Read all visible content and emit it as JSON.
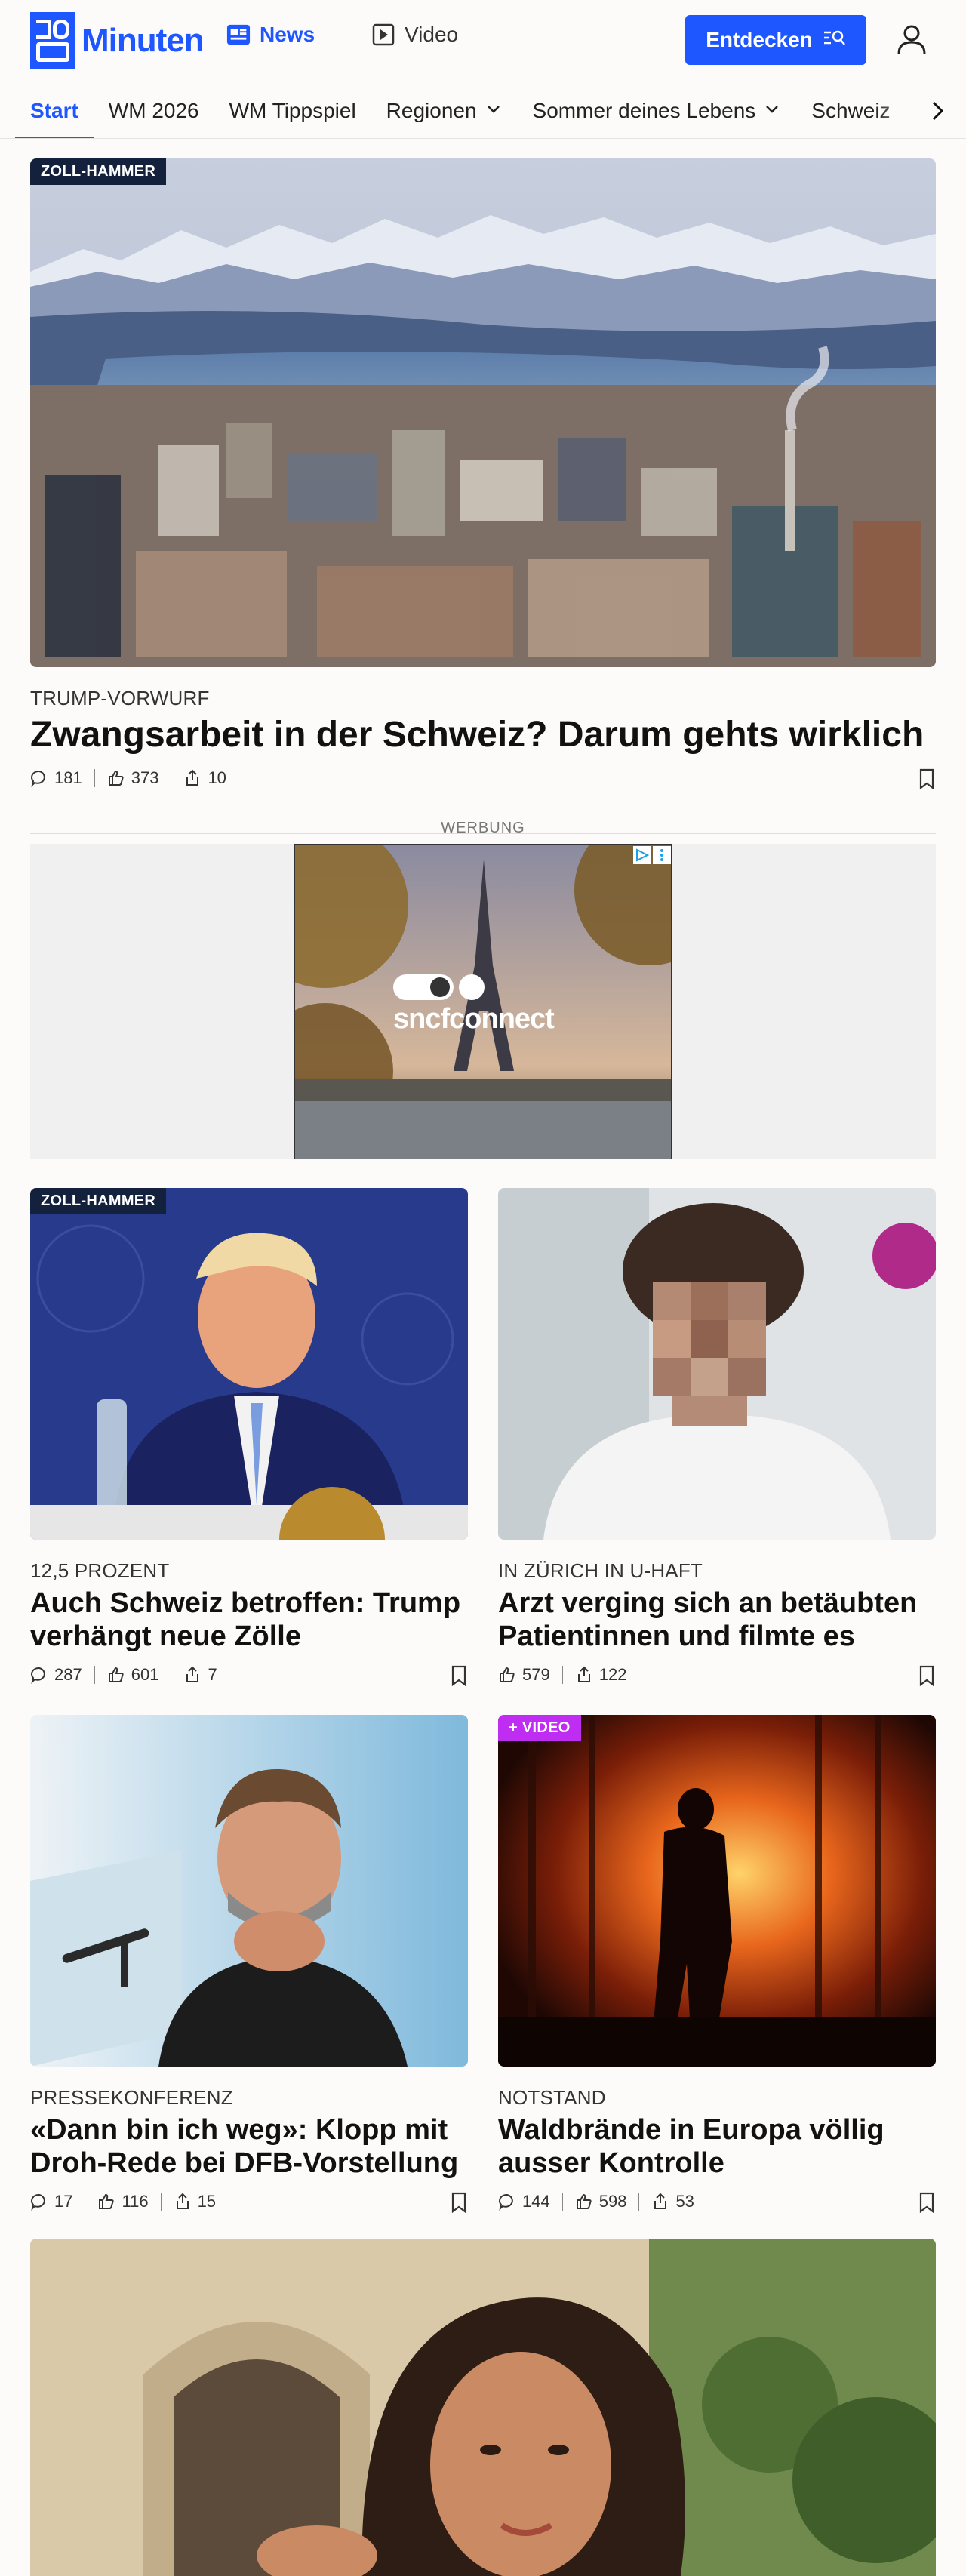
{
  "header": {
    "logo_text": "Minuten",
    "nav_news": "News",
    "nav_video": "Video",
    "discover_button": "Entdecken"
  },
  "subnav": {
    "items": [
      "Start",
      "WM 2026",
      "WM Tippspiel",
      "Regionen",
      "Sommer deines Lebens",
      "Schweiz"
    ]
  },
  "articles": [
    {
      "badge": "ZOLL-HAMMER",
      "kicker": "TRUMP-VORWURF",
      "title": "Zwangsarbeit in der Schweiz? Darum gehts wirklich",
      "comments": "181",
      "likes": "373",
      "shares": "10"
    },
    {
      "badge": "ZOLL-HAMMER",
      "kicker": "12,5 PROZENT",
      "title": "Auch Schweiz betroffen: Trump verhängt neue Zölle",
      "comments": "287",
      "likes": "601",
      "shares": "7"
    },
    {
      "kicker": "IN ZÜRICH IN U-HAFT",
      "title": "Arzt verging sich an betäubten Patientinnen und filmte es",
      "likes": "579",
      "shares": "122"
    },
    {
      "kicker": "PRESSEKONFERENZ",
      "title": "«Dann bin ich weg»: Klopp mit Droh-Rede bei DFB-Vorstellung",
      "comments": "17",
      "likes": "116",
      "shares": "15"
    },
    {
      "badge": "+ VIDEO",
      "kicker": "NOTSTAND",
      "title": "Waldbrände in Europa völlig ausser Kontrolle",
      "comments": "144",
      "likes": "598",
      "shares": "53"
    }
  ],
  "ad": {
    "label": "WERBUNG",
    "brand": "sncfconnect"
  },
  "colors": {
    "brand_blue": "#1e56ff",
    "badge_navy": "#14213d",
    "video_purple": "#c02df2"
  },
  "icons": [
    "news-icon",
    "video-icon",
    "search-icon",
    "user-icon",
    "chevron-down-icon",
    "chevron-right-icon",
    "comment-icon",
    "like-icon",
    "share-icon",
    "bookmark-icon"
  ]
}
